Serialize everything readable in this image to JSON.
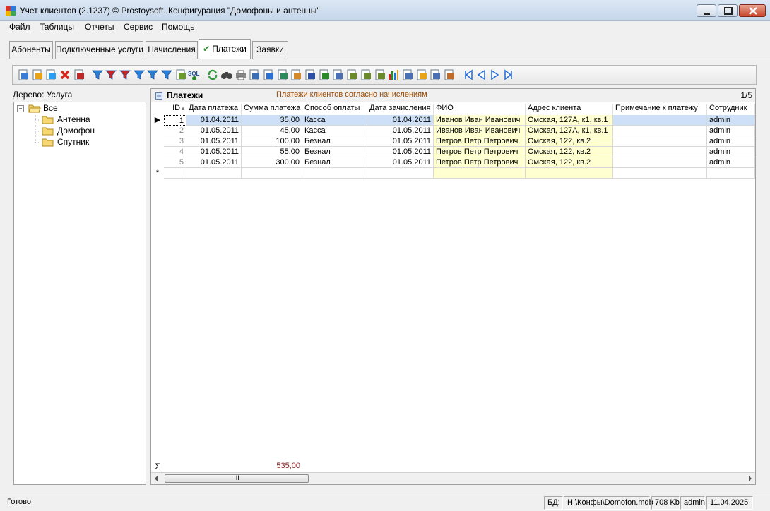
{
  "window": {
    "title": "Учет клиентов (2.1237) © Prostoysoft. Конфигурация \"Домофоны и антенны\""
  },
  "menu": [
    "Файл",
    "Таблицы",
    "Отчеты",
    "Сервис",
    "Помощь"
  ],
  "tabs": [
    {
      "label": "Абоненты",
      "active": false
    },
    {
      "label": "Подключенные услуги",
      "active": false
    },
    {
      "label": "Начисления",
      "active": false
    },
    {
      "label": "Платежи",
      "active": true
    },
    {
      "label": "Заявки",
      "active": false
    }
  ],
  "toolbar_icons": [
    "add-icon",
    "edit-icon",
    "copy-icon",
    "delete-icon",
    "delete-all-icon",
    "filter-icon",
    "filter-clear-icon",
    "filter-delete-icon",
    "filter-down-icon",
    "filter-up-icon",
    "filter-panel-icon",
    "tree-icon",
    "sql-icon",
    "refresh-icon",
    "find-icon",
    "print-icon",
    "preview-icon",
    "export-1-icon",
    "export-2-icon",
    "export-3-icon",
    "word-icon",
    "excel-icon",
    "export-4-icon",
    "export-5-icon",
    "export-6-icon",
    "export-7-icon",
    "chart-icon",
    "doc-1-icon",
    "doc-2-icon",
    "grid-settings-icon",
    "grid-layout-icon",
    "first-icon",
    "prev-icon",
    "next-icon",
    "last-icon"
  ],
  "tree": {
    "label": "Дерево: Услуга",
    "root": "Все",
    "children": [
      "Антенна",
      "Домофон",
      "Спутник"
    ]
  },
  "grid": {
    "title": "Платежи",
    "subtitle": "Платежи клиентов согласно начислениям",
    "count": "1/5",
    "columns": [
      "ID",
      "Дата платежа",
      "Сумма платежа",
      "Способ оплаты",
      "Дата зачисления",
      "ФИО",
      "Адрес клиента",
      "Примечание к платежу",
      "Сотрудник"
    ],
    "rows": [
      {
        "id": "1",
        "date": "01.04.2011",
        "sum": "35,00",
        "method": "Касса",
        "credit_date": "01.04.2011",
        "fio": "Иванов Иван Иванович",
        "address": "Омская, 127А, к1, кв.1",
        "note": "",
        "employee": "admin"
      },
      {
        "id": "2",
        "date": "01.05.2011",
        "sum": "45,00",
        "method": "Касса",
        "credit_date": "01.05.2011",
        "fio": "Иванов Иван Иванович",
        "address": "Омская, 127А, к1, кв.1",
        "note": "",
        "employee": "admin"
      },
      {
        "id": "3",
        "date": "01.05.2011",
        "sum": "100,00",
        "method": "Безнал",
        "credit_date": "01.05.2011",
        "fio": "Петров Петр Петрович",
        "address": "Омская, 122, кв.2",
        "note": "",
        "employee": "admin"
      },
      {
        "id": "4",
        "date": "01.05.2011",
        "sum": "55,00",
        "method": "Безнал",
        "credit_date": "01.05.2011",
        "fio": "Петров Петр Петрович",
        "address": "Омская, 122, кв.2",
        "note": "",
        "employee": "admin"
      },
      {
        "id": "5",
        "date": "01.05.2011",
        "sum": "300,00",
        "method": "Безнал",
        "credit_date": "01.05.2011",
        "fio": "Петров Петр Петрович",
        "address": "Омская, 122, кв.2",
        "note": "",
        "employee": "admin"
      }
    ],
    "total_sum": "535,00",
    "sigma": "Σ",
    "new_row_marker": "*",
    "current_row_marker": "▶",
    "sort_marker": "▲",
    "scroll_thumb": "III"
  },
  "status": {
    "state": "Готово",
    "db_label": "БД:",
    "db_path": "H:\\Конфы\\Domofon.mdb",
    "db_size": "708 Kb",
    "user": "admin",
    "date": "11.04.2025"
  },
  "colors": {
    "highlight": "#ffffd2",
    "selected": "#cde0f7",
    "subtitle": "#9c4a00",
    "total": "#8b1a1a"
  }
}
